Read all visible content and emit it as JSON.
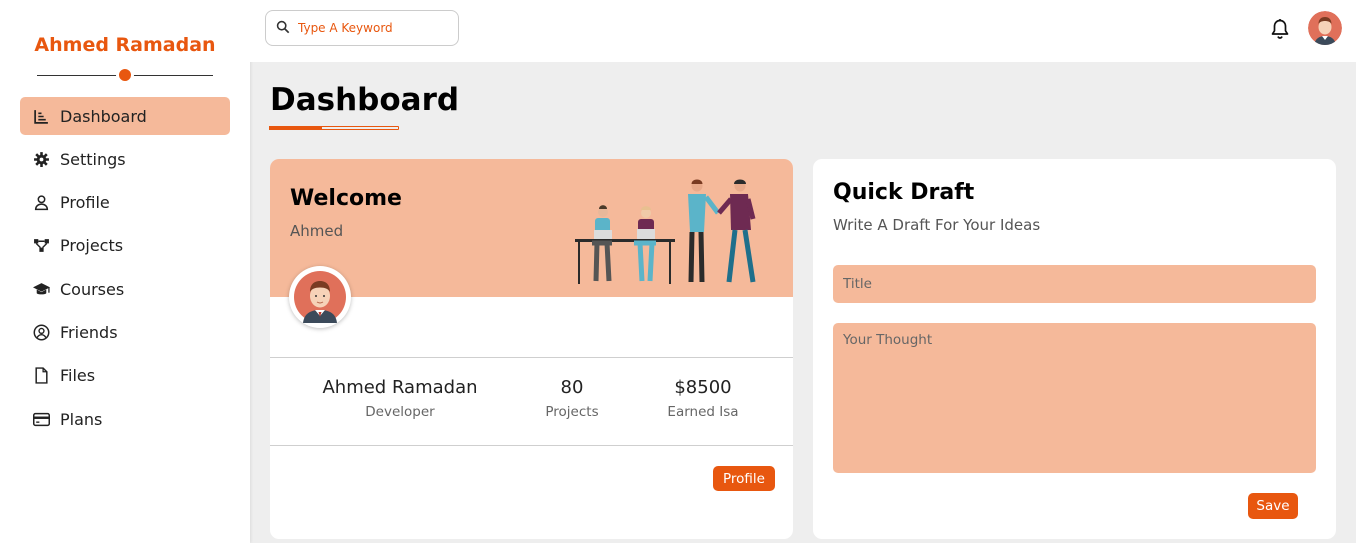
{
  "brand": {
    "name": "Ahmed Ramadan",
    "accent": "#e8570f"
  },
  "sidebar": {
    "items": [
      {
        "label": "Dashboard",
        "icon": "chart-icon",
        "active": true
      },
      {
        "label": "Settings",
        "icon": "gear-icon"
      },
      {
        "label": "Profile",
        "icon": "user-icon"
      },
      {
        "label": "Projects",
        "icon": "diagram-icon"
      },
      {
        "label": "Courses",
        "icon": "graduation-cap-icon"
      },
      {
        "label": "Friends",
        "icon": "user-circle-icon"
      },
      {
        "label": "Files",
        "icon": "file-icon"
      },
      {
        "label": "Plans",
        "icon": "credit-card-icon"
      }
    ]
  },
  "header": {
    "search_placeholder": "Type A Keyword",
    "search_icon": "search-icon",
    "bell_icon": "bell-icon"
  },
  "page": {
    "title": "Dashboard"
  },
  "welcome": {
    "title": "Welcome",
    "name": "Ahmed",
    "stats": [
      {
        "value": "Ahmed Ramadan",
        "label": "Developer"
      },
      {
        "value": "80",
        "label": "Projects"
      },
      {
        "value": "$8500",
        "label": "Earned Isa"
      }
    ],
    "button": "Profile"
  },
  "draft": {
    "title": "Quick Draft",
    "subtitle": "Write A Draft For Your Ideas",
    "title_placeholder": "Title",
    "thought_placeholder": "Your Thought",
    "button": "Save"
  },
  "colors": {
    "accent": "#e8570f",
    "peach": "#f5b99a",
    "background": "#eeeeee"
  }
}
